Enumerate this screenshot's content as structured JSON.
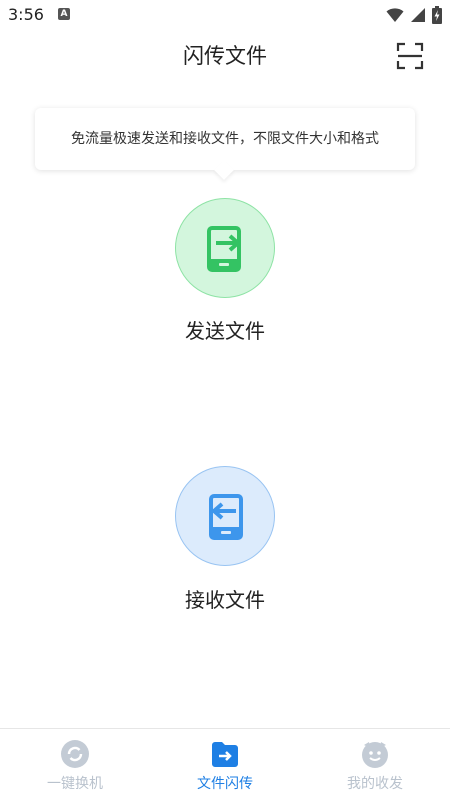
{
  "status_bar": {
    "time": "3:56",
    "notification_icon": "A"
  },
  "header": {
    "title": "闪传文件",
    "scan_icon": "scan-icon"
  },
  "tooltip": {
    "text": "免流量极速发送和接收文件，不限文件大小和格式"
  },
  "actions": {
    "send": {
      "label": "发送文件",
      "icon": "send-file-icon",
      "color": "#34c363"
    },
    "receive": {
      "label": "接收文件",
      "icon": "receive-file-icon",
      "color": "#3d96ec"
    }
  },
  "tabs": [
    {
      "label": "一键换机",
      "icon": "switch-phone-icon",
      "active": false
    },
    {
      "label": "文件闪传",
      "icon": "file-transfer-icon",
      "active": true
    },
    {
      "label": "我的收发",
      "icon": "my-transfers-icon",
      "active": false
    }
  ],
  "colors": {
    "accent": "#1e7fe4",
    "inactive": "#b9c2cd"
  }
}
